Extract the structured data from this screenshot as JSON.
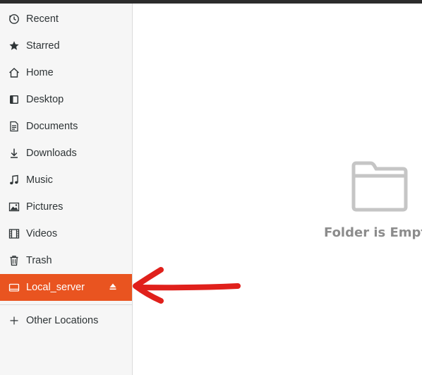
{
  "sidebar": {
    "items": [
      {
        "label": "Recent",
        "icon": "clock-icon"
      },
      {
        "label": "Starred",
        "icon": "star-icon"
      },
      {
        "label": "Home",
        "icon": "home-icon"
      },
      {
        "label": "Desktop",
        "icon": "desktop-icon"
      },
      {
        "label": "Documents",
        "icon": "document-icon"
      },
      {
        "label": "Downloads",
        "icon": "download-icon"
      },
      {
        "label": "Music",
        "icon": "music-icon"
      },
      {
        "label": "Pictures",
        "icon": "picture-icon"
      },
      {
        "label": "Videos",
        "icon": "video-icon"
      },
      {
        "label": "Trash",
        "icon": "trash-icon"
      },
      {
        "label": "Local_server",
        "icon": "drive-icon",
        "active": true,
        "eject_icon": "eject-icon"
      }
    ],
    "other_locations": {
      "label": "Other Locations",
      "icon": "plus-icon"
    }
  },
  "main": {
    "empty_label": "Folder is Empt",
    "empty_icon": "folder-icon"
  },
  "annotation": {
    "icon": "red-arrow-annotation",
    "color": "#e0201b"
  },
  "colors": {
    "accent": "#e95420",
    "sidebar_bg": "#f6f6f6",
    "text": "#2e3436",
    "muted": "#8c8c8c"
  }
}
